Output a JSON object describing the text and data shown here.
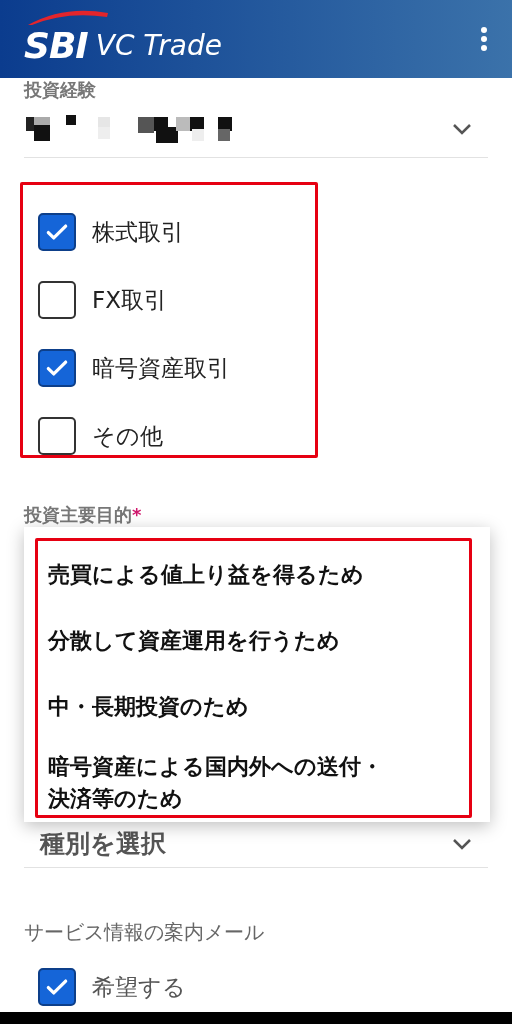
{
  "header": {
    "logo_mark": "SBI",
    "logo_text": "VC Trade"
  },
  "experience": {
    "label": "投資経験",
    "options": [
      {
        "label": "株式取引",
        "checked": true
      },
      {
        "label": "FX取引",
        "checked": false
      },
      {
        "label": "暗号資産取引",
        "checked": true
      },
      {
        "label": "その他",
        "checked": false
      }
    ]
  },
  "purpose": {
    "label": "投資主要目的",
    "required_mark": "*",
    "placeholder": "種別を選択",
    "menu_items": [
      "売買による値上り益を得るため",
      "分散して資産運用を行うため",
      "中・長期投資のため",
      "暗号資産による国内外への送付・決済等のため"
    ]
  },
  "mail": {
    "label": "サービス情報の案内メール",
    "option": {
      "label": "希望する",
      "checked": true
    }
  }
}
